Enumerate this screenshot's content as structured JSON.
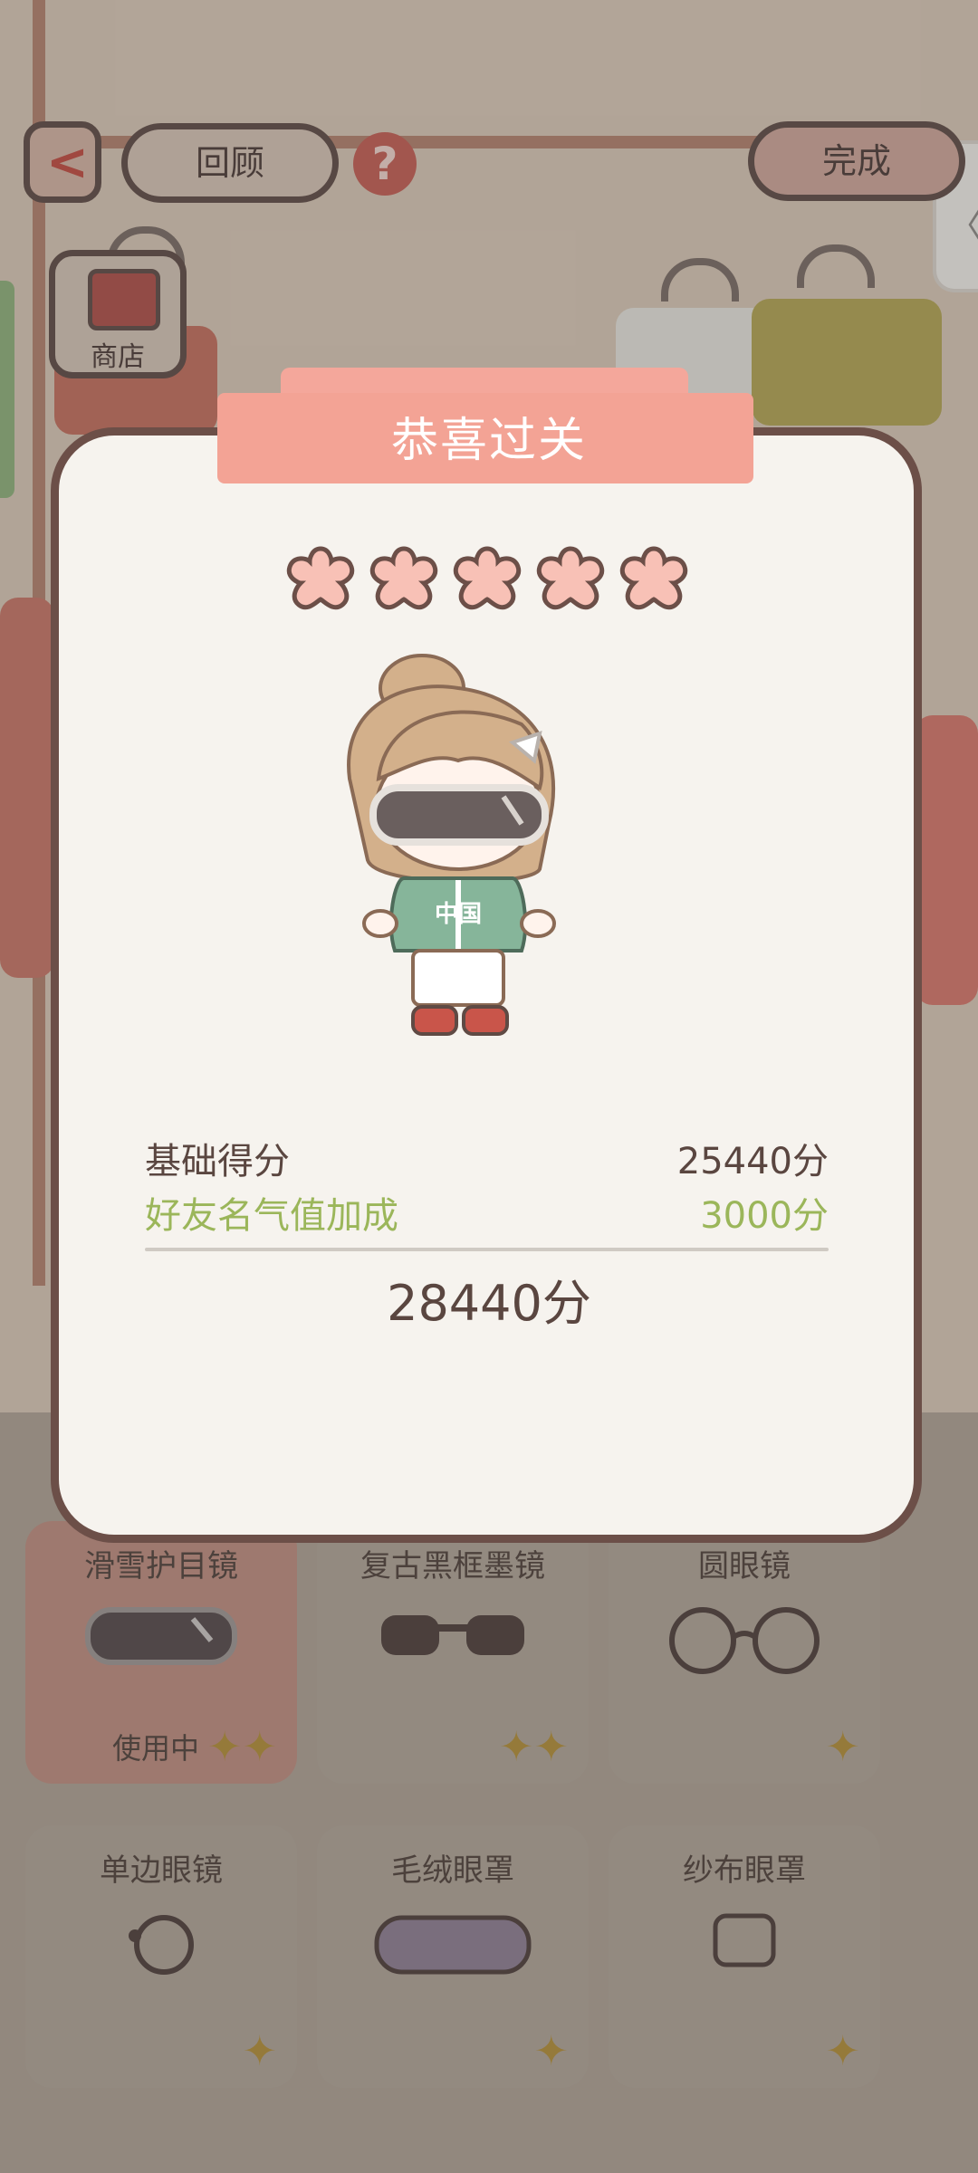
{
  "header": {
    "back_icon": "chevron-left-icon",
    "review_label": "回顾",
    "help_icon": "question-icon",
    "done_label": "完成",
    "side_pull_icon": "chevron-left-icon"
  },
  "shop": {
    "label": "商店",
    "icon": "shop-icon"
  },
  "dialog": {
    "title": "恭喜过关",
    "stars_earned": 5,
    "stars_total": 5,
    "score": {
      "base_label": "基础得分",
      "base_value": "25440分",
      "bonus_label": "好友名气值加成",
      "bonus_value": "3000分",
      "total": "28440分"
    },
    "avatar_shirt_text": "中国"
  },
  "items": [
    {
      "name": "滑雪护目镜",
      "status": "使用中",
      "icon": "ski-goggles-icon",
      "active": true
    },
    {
      "name": "复古黑框墨镜",
      "status": "",
      "icon": "sunglasses-icon",
      "active": false
    },
    {
      "name": "圆眼镜",
      "status": "",
      "icon": "round-glasses-icon",
      "active": false
    },
    {
      "name": "单边眼镜",
      "status": "",
      "icon": "monocle-icon",
      "active": false
    },
    {
      "name": "毛绒眼罩",
      "status": "",
      "icon": "plush-eye-mask-icon",
      "active": false
    },
    {
      "name": "纱布眼罩",
      "status": "",
      "icon": "gauze-eye-patch-icon",
      "active": false
    }
  ],
  "colors": {
    "dialog_border": "#6c4f48",
    "ribbon": "#f3a395",
    "star_fill": "#f8c1b6",
    "bonus_text": "#9bb65a"
  }
}
